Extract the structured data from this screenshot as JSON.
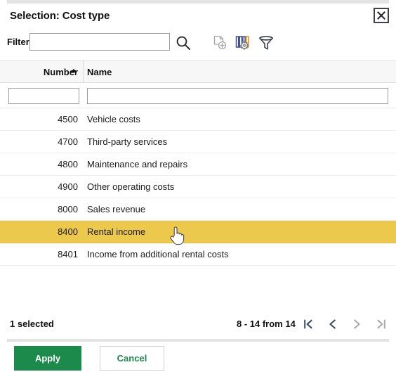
{
  "dialog": {
    "title": "Selection: Cost type",
    "close_label": "×",
    "close_icon": "close-icon"
  },
  "filter_bar": {
    "label": "Filter",
    "value": "",
    "placeholder": "",
    "tools": [
      {
        "name": "search-icon",
        "tooltip": "Search"
      },
      {
        "name": "new-document-icon",
        "tooltip": "New"
      },
      {
        "name": "column-settings-icon",
        "tooltip": "Columns"
      },
      {
        "name": "filter-funnel-icon",
        "tooltip": "Filter"
      }
    ]
  },
  "table": {
    "columns": [
      {
        "key": "number",
        "label": "Number",
        "sort": "asc",
        "align": "right"
      },
      {
        "key": "name",
        "label": "Name",
        "sort": "none",
        "align": "left"
      }
    ],
    "column_filters": {
      "number": "",
      "name": ""
    },
    "rows": [
      {
        "number": "4500",
        "name": "Vehicle costs",
        "selected": false
      },
      {
        "number": "4700",
        "name": "Third-party services",
        "selected": false
      },
      {
        "number": "4800",
        "name": "Maintenance and repairs",
        "selected": false
      },
      {
        "number": "4900",
        "name": "Other operating costs",
        "selected": false
      },
      {
        "number": "8000",
        "name": "Sales revenue",
        "selected": false
      },
      {
        "number": "8400",
        "name": "Rental income",
        "selected": true
      },
      {
        "number": "8401",
        "name": "Income from additional rental costs",
        "selected": false
      }
    ]
  },
  "footer": {
    "selected_count": "1 selected",
    "page_range": "8 - 14 from 14",
    "pager": [
      {
        "name": "first-page-button",
        "glyph": "|<",
        "enabled": true
      },
      {
        "name": "previous-page-button",
        "glyph": "<",
        "enabled": true
      },
      {
        "name": "next-page-button",
        "glyph": ">",
        "enabled": false
      },
      {
        "name": "last-page-button",
        "glyph": ">|",
        "enabled": false
      }
    ]
  },
  "actions": {
    "apply_label": "Apply",
    "cancel_label": "Cancel"
  },
  "colors": {
    "accent_green": "#1b8a4b",
    "selected_row": "#ecc84c",
    "header_bg": "#f7f7f7",
    "border": "#9b9b9b"
  }
}
